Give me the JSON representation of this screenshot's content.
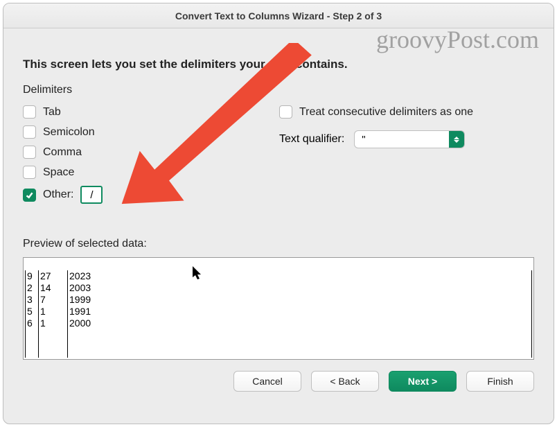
{
  "title": "Convert Text to Columns Wizard - Step 2 of 3",
  "instruction": "This screen lets you set the delimiters your data contains.",
  "delimiters_label": "Delimiters",
  "delimiters": {
    "tab": "Tab",
    "semicolon": "Semicolon",
    "comma": "Comma",
    "space": "Space",
    "other": "Other:",
    "other_value": "/"
  },
  "treat_consecutive": "Treat consecutive delimiters as one",
  "qualifier_label": "Text qualifier:",
  "qualifier_value": "\"",
  "preview_label": "Preview of selected data:",
  "preview_rows": [
    [
      "9",
      "27",
      "2023"
    ],
    [
      "2",
      "14",
      "2003"
    ],
    [
      "3",
      "7",
      "1999"
    ],
    [
      "5",
      "1",
      "1991"
    ],
    [
      "6",
      "1",
      "2000"
    ]
  ],
  "buttons": {
    "cancel": "Cancel",
    "back": "< Back",
    "next": "Next >",
    "finish": "Finish"
  },
  "watermark": "groovyPost.com"
}
